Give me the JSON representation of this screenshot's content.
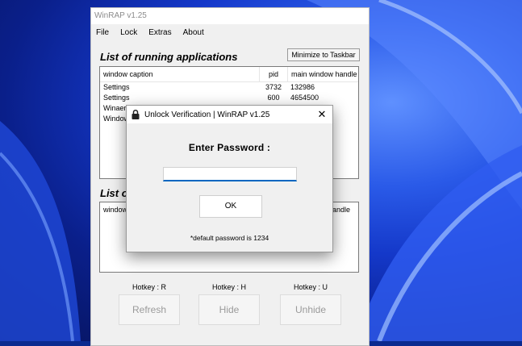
{
  "window": {
    "title": "WinRAP v1.25"
  },
  "menu": [
    "File",
    "Lock",
    "Extras",
    "About"
  ],
  "running": {
    "title": "List of running applications",
    "minimize_label": "Minimize to Taskbar",
    "columns": [
      "window caption",
      "pid",
      "main window handle"
    ],
    "rows": [
      {
        "caption": "Settings",
        "pid": "3732",
        "handle": "132986"
      },
      {
        "caption": "Settings",
        "pid": "600",
        "handle": "4654500"
      },
      {
        "caption": "Winaero Tweaker",
        "pid": "",
        "handle": ""
      },
      {
        "caption": "Window",
        "pid": "",
        "handle": ""
      }
    ]
  },
  "second": {
    "title_visible": "List o",
    "col_left": "window",
    "col_right": "handle"
  },
  "hotkeys": [
    {
      "label": "Hotkey : R",
      "button": "Refresh"
    },
    {
      "label": "Hotkey : H",
      "button": "Hide"
    },
    {
      "label": "Hotkey : U",
      "button": "Unhide"
    }
  ],
  "dialog": {
    "title": "Unlock Verification | WinRAP v1.25",
    "close": "✕",
    "prompt": "Enter Password :",
    "input_value": "",
    "ok_label": "OK",
    "note": "*default password is 1234",
    "icon": "lock-icon"
  }
}
